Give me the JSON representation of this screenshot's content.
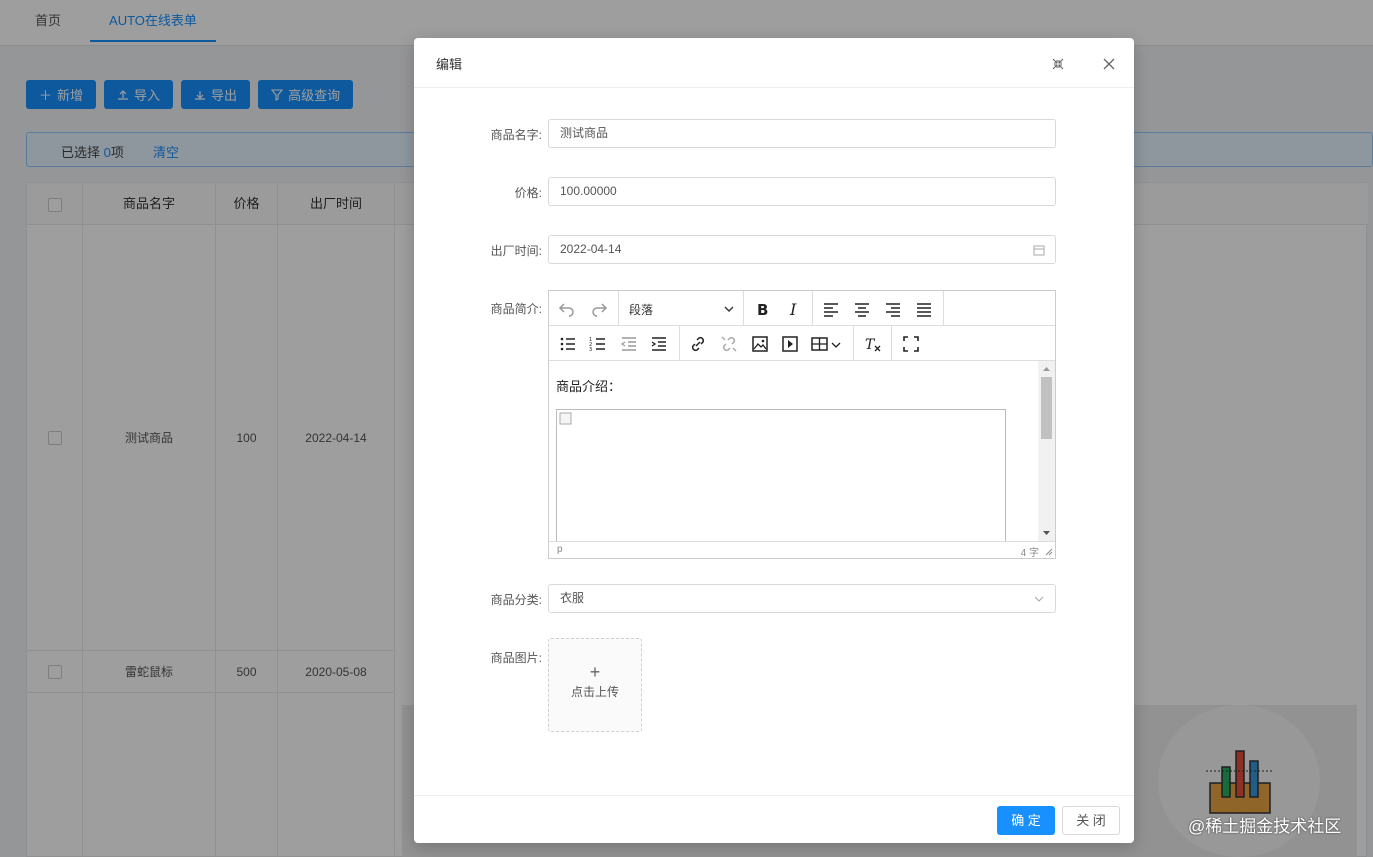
{
  "tabs": [
    {
      "label": "首页"
    },
    {
      "label": "AUTO在线表单"
    }
  ],
  "toolbar": {
    "add": "新增",
    "import": "导入",
    "export": "导出",
    "advanced": "高级查询"
  },
  "selection": {
    "prefix": "已选择",
    "count": "0",
    "suffix": "项",
    "clear": "清空"
  },
  "table": {
    "headers": [
      "商品名字",
      "价格",
      "出厂时间"
    ],
    "rows": [
      {
        "name": "测试商品",
        "price": "100",
        "date": "2022-04-14"
      },
      {
        "name": "雷蛇鼠标",
        "price": "500",
        "date": "2020-05-08"
      }
    ]
  },
  "modal": {
    "title": "编辑",
    "fields": {
      "name_label": "商品名字:",
      "name_value": "测试商品",
      "price_label": "价格:",
      "price_value": "100.00000",
      "date_label": "出厂时间:",
      "date_value": "2022-04-14",
      "intro_label": "商品简介:",
      "category_label": "商品分类:",
      "category_value": "衣服",
      "image_label": "商品图片:",
      "upload_plus": "+",
      "upload_text": "点击上传"
    },
    "editor": {
      "paragraph_select": "段落",
      "content_text": "商品介绍：",
      "status_path": "p",
      "word_count": "4 字"
    },
    "footer": {
      "ok": "确 定",
      "close": "关 闭"
    }
  },
  "watermark": "@稀土掘金技术社区",
  "colors": {
    "primary": "#1890ff",
    "overlay": "rgba(0,0,0,0.38)"
  }
}
